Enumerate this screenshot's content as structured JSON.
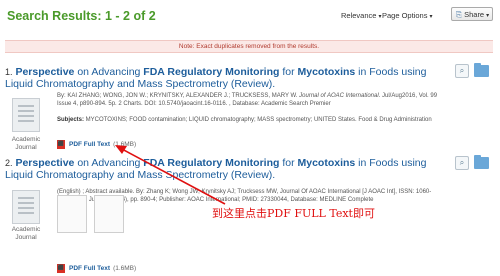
{
  "header": {
    "title": "Search Results: 1 - 2 of 2",
    "relevance": "Relevance",
    "page_options": "Page Options",
    "share": "Share"
  },
  "notice": "Note: Exact duplicates removed from the results.",
  "results": [
    {
      "number": "1.",
      "title_parts": [
        "Perspective",
        " on Advancing ",
        "FDA Regulatory Monitoring",
        " for ",
        "Mycotoxins",
        " in Foods using Liquid Chromatography and Mass Spectrometry (Review)."
      ],
      "type": "Academic Journal",
      "meta_prefix": "By: KAI ZHANG; WONG, JON W.; KRYNITSKY, ALEXANDER J.; TRUCKSESS, MARY W. ",
      "meta_journal": "Journal of AOAC International",
      "meta_suffix": ". Jul/Aug2016, Vol. 99 Issue 4, p890-894. 5p. 2 Charts. DOI: 10.5740/jaoacint.16-0116. , Database: Academic Search Premier",
      "subjects_label": "Subjects:",
      "subjects": " MYCOTOXINS; FOOD contamination; LIQUID chromatography; MASS spectrometry; UNITED States. Food & Drug Administration",
      "pdf_label": "PDF Full Text",
      "pdf_size": "(1.6MB)"
    },
    {
      "number": "2.",
      "title_parts": [
        "Perspective",
        " on Advancing ",
        "FDA Regulatory Monitoring",
        " for ",
        "Mycotoxins",
        " in Foods using Liquid Chromatography and Mass Spectrometry (Review)."
      ],
      "type": "Academic Journal",
      "meta": "(English) ; Abstract available. By: Zhang K; Wong JW; Krynitsky AJ; Trucksess MW, Journal Of AOAC International [J AOAC Int], ISSN: 1060-3271, 2016 Jul; Vol. 99 (4), pp. 890-4; Publisher: AOAC International; PMID: 27330044, Database: MEDLINE Complete",
      "pdf_label": "PDF Full Text",
      "pdf_size": "(1.6MB)"
    }
  ],
  "annotation": "到这里点击PDF FULL Text即可",
  "colors": {
    "accent_green": "#4a9a2a",
    "link_blue": "#1d5d9b",
    "annotation_red": "#e01010"
  }
}
